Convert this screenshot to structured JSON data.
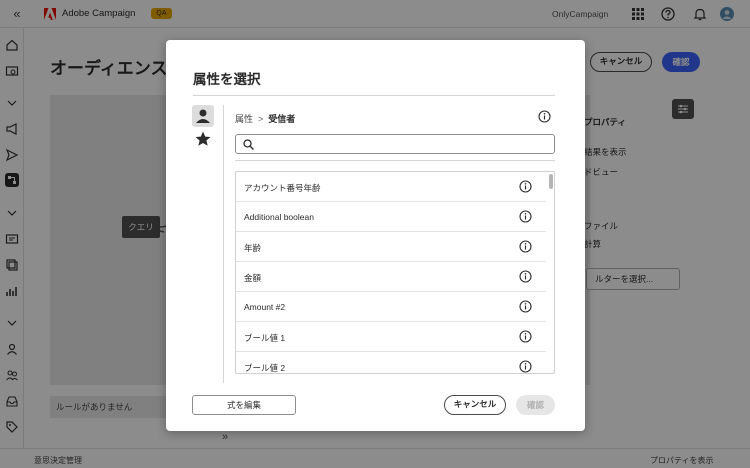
{
  "topbar": {
    "app_name": "Adobe Campaign",
    "badge": "QA",
    "org": "OnlyCampaign"
  },
  "page": {
    "title": "オーディエンス",
    "cancel_label": "キャンセル",
    "confirm_label": "確認",
    "query_node": "クエリ",
    "right_panel": {
      "properties": "プロパティ",
      "show_results": "結果を表示",
      "preview": "ドビュー",
      "file": "ファイル",
      "calc": "計算",
      "filter_button": "ルターを選択..."
    },
    "rules_label": "ルールがありません"
  },
  "statusbar": {
    "left": "意思決定管理",
    "right": "プロパティを表示"
  },
  "modal": {
    "title": "属性を選択",
    "breadcrumb": {
      "root": "属性",
      "separator": ">",
      "current": "受信者"
    },
    "search": {
      "placeholder": "",
      "value": ""
    },
    "attributes": [
      {
        "label": "アカウント番号年齢"
      },
      {
        "label": "Additional boolean"
      },
      {
        "label": "年齢"
      },
      {
        "label": "金額"
      },
      {
        "label": "Amount #2"
      },
      {
        "label": "ブール値 1"
      },
      {
        "label": "ブール値 2"
      }
    ],
    "edit_expression_label": "式を編集",
    "cancel_label": "キャンセル",
    "confirm_label": "確認",
    "expand_glyph": "»"
  },
  "colors": {
    "accent_blue": "#3b63fb",
    "badge": "#e8a800",
    "overlay": "rgba(0,0,0,0.45)"
  }
}
